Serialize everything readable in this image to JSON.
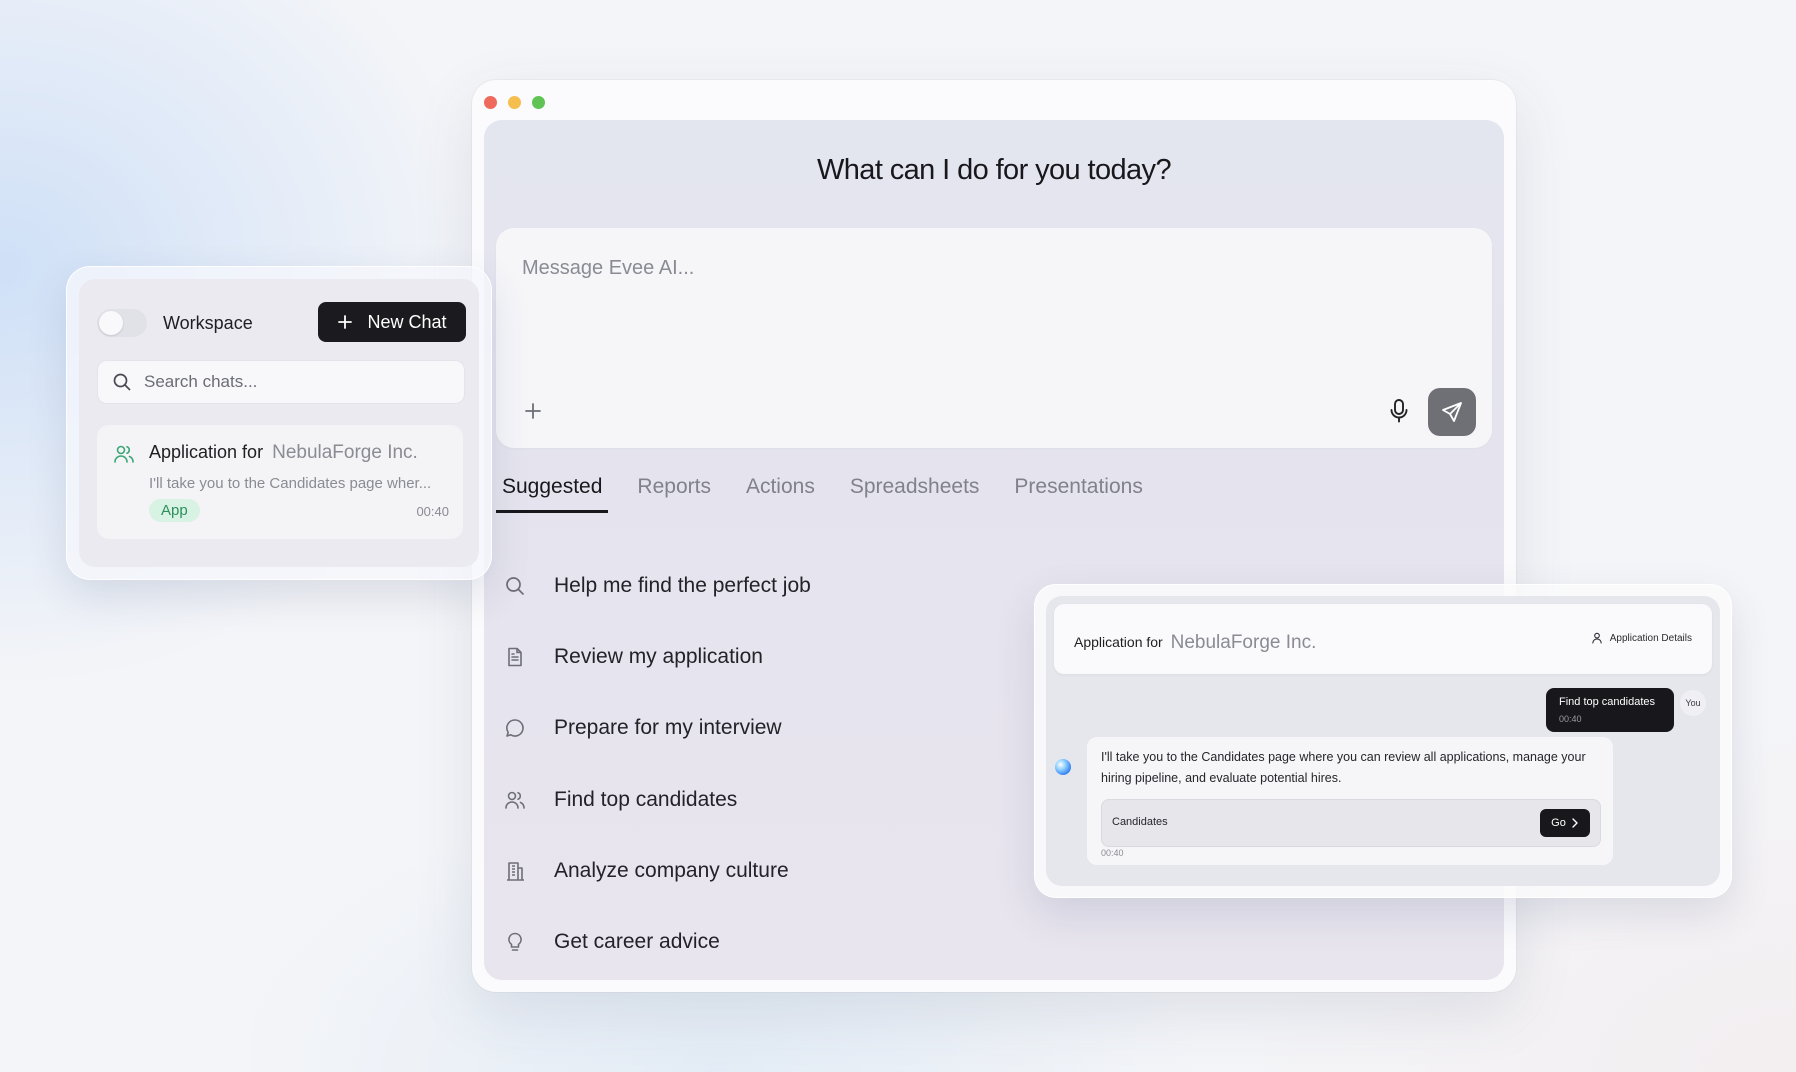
{
  "main": {
    "title": "What can I do for you today?",
    "composer_placeholder": "Message Evee AI...",
    "icons": {
      "attach": "plus-icon",
      "mic": "microphone-icon",
      "send": "send-icon"
    },
    "tabs": [
      {
        "label": "Suggested",
        "active": true
      },
      {
        "label": "Reports",
        "active": false
      },
      {
        "label": "Actions",
        "active": false
      },
      {
        "label": "Spreadsheets",
        "active": false
      },
      {
        "label": "Presentations",
        "active": false
      }
    ],
    "suggestions": [
      {
        "label": "Help me find the perfect job",
        "icon": "search-icon"
      },
      {
        "label": "Review my application",
        "icon": "document-icon"
      },
      {
        "label": "Prepare for my interview",
        "icon": "chat-bubble-icon"
      },
      {
        "label": "Find top candidates",
        "icon": "people-icon"
      },
      {
        "label": "Analyze company culture",
        "icon": "building-icon"
      },
      {
        "label": "Get career advice",
        "icon": "lightbulb-icon"
      }
    ]
  },
  "sidebar": {
    "workspace_label": "Workspace",
    "new_chat_label": "New Chat",
    "search_placeholder": "Search chats...",
    "chats": [
      {
        "title_prefix": "Application for",
        "company": "NebulaForge Inc.",
        "preview": "I'll take you to the Candidates page wher...",
        "badge": "App",
        "time": "00:40"
      }
    ]
  },
  "preview": {
    "title_prefix": "Application for",
    "company": "NebulaForge Inc.",
    "details_label": "Application Details",
    "user_message": "Find top candidates",
    "user_time": "00:40",
    "you_label": "You",
    "ai_message": "I'll take you to the Candidates page where you can review all applications, manage your hiring pipeline, and evaluate potential hires.",
    "link_label": "Candidates",
    "go_label": "Go",
    "ai_time": "00:40"
  },
  "colors": {
    "accent_dark": "#1b1b1f",
    "badge_bg": "#d8f2e4",
    "badge_text": "#2f8f5c",
    "people_icon": "#3aa676"
  }
}
